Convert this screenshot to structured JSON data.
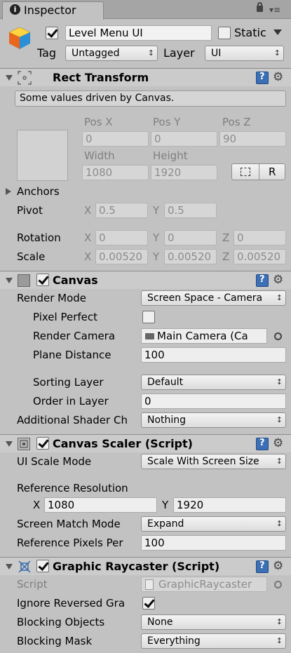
{
  "tab": {
    "title": "Inspector"
  },
  "object": {
    "active": true,
    "name": "Level Menu UI",
    "static_label": "Static",
    "static_checked": false,
    "tag_label": "Tag",
    "tag_value": "Untagged",
    "layer_label": "Layer",
    "layer_value": "UI"
  },
  "rect_transform": {
    "title": "Rect Transform",
    "note": "Some values driven by Canvas.",
    "pos_x_label": "Pos X",
    "pos_y_label": "Pos Y",
    "pos_z_label": "Pos Z",
    "pos_x": "0",
    "pos_y": "0",
    "pos_z": "90",
    "width_label": "Width",
    "height_label": "Height",
    "width": "1080",
    "height": "1920",
    "raw_button": "R",
    "anchors_label": "Anchors",
    "pivot_label": "Pivot",
    "pivot_x": "0.5",
    "pivot_y": "0.5",
    "rotation_label": "Rotation",
    "rot_x": "0",
    "rot_y": "0",
    "rot_z": "0",
    "scale_label": "Scale",
    "scale_x": "0.00520",
    "scale_y": "0.00520",
    "scale_z": "0.00520",
    "x": "X",
    "y": "Y",
    "z": "Z"
  },
  "canvas": {
    "title": "Canvas",
    "enabled": true,
    "render_mode_label": "Render Mode",
    "render_mode": "Screen Space - Camera",
    "pixel_perfect_label": "Pixel Perfect",
    "pixel_perfect": false,
    "render_camera_label": "Render Camera",
    "render_camera": "Main Camera (Ca",
    "plane_distance_label": "Plane Distance",
    "plane_distance": "100",
    "sorting_layer_label": "Sorting Layer",
    "sorting_layer": "Default",
    "order_label": "Order in Layer",
    "order": "0",
    "shader_label": "Additional Shader Ch",
    "shader": "Nothing"
  },
  "scaler": {
    "title": "Canvas Scaler (Script)",
    "enabled": true,
    "ui_scale_label": "UI Scale Mode",
    "ui_scale": "Scale With Screen Size",
    "ref_res_label": "Reference Resolution",
    "ref_x": "1080",
    "ref_y": "1920",
    "match_label": "Screen Match Mode",
    "match": "Expand",
    "ppu_label": "Reference Pixels Per",
    "ppu": "100"
  },
  "raycaster": {
    "title": "Graphic Raycaster (Script)",
    "enabled": true,
    "script_label": "Script",
    "script": "GraphicRaycaster",
    "ignore_label": "Ignore Reversed Gra",
    "ignore": true,
    "blocking_objects_label": "Blocking Objects",
    "blocking_objects": "None",
    "blocking_mask_label": "Blocking Mask",
    "blocking_mask": "Everything"
  }
}
